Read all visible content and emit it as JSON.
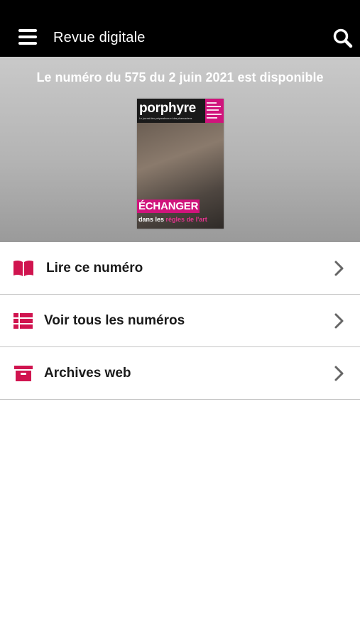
{
  "header": {
    "title": "Revue digitale",
    "menu_icon": "hamburger-menu-icon",
    "search_icon": "search-icon",
    "background": "#000000"
  },
  "hero": {
    "headline": "Le numéro du 575 du 2 juin 2021 est disponible",
    "cover": {
      "brand": "porphyre",
      "tagline": "Le journal des préparateurs et des pharmaciens",
      "banner": "ÉCHANGER",
      "subline_plain": "dans les",
      "subline_highlight": "règles de l'art"
    }
  },
  "menu": {
    "items": [
      {
        "label": "Lire ce numéro",
        "icon": "open-book-icon",
        "chevron_icon": "chevron-right-icon"
      },
      {
        "label": "Voir tous les numéros",
        "icon": "list-icon",
        "chevron_icon": "chevron-right-icon"
      },
      {
        "label": "Archives web",
        "icon": "archive-box-icon",
        "chevron_icon": "chevron-right-icon"
      }
    ]
  },
  "colors": {
    "accent": "#d0144f",
    "cover_pink": "#d0147c",
    "chevron": "#666666",
    "divider": "#c4c4c4"
  }
}
